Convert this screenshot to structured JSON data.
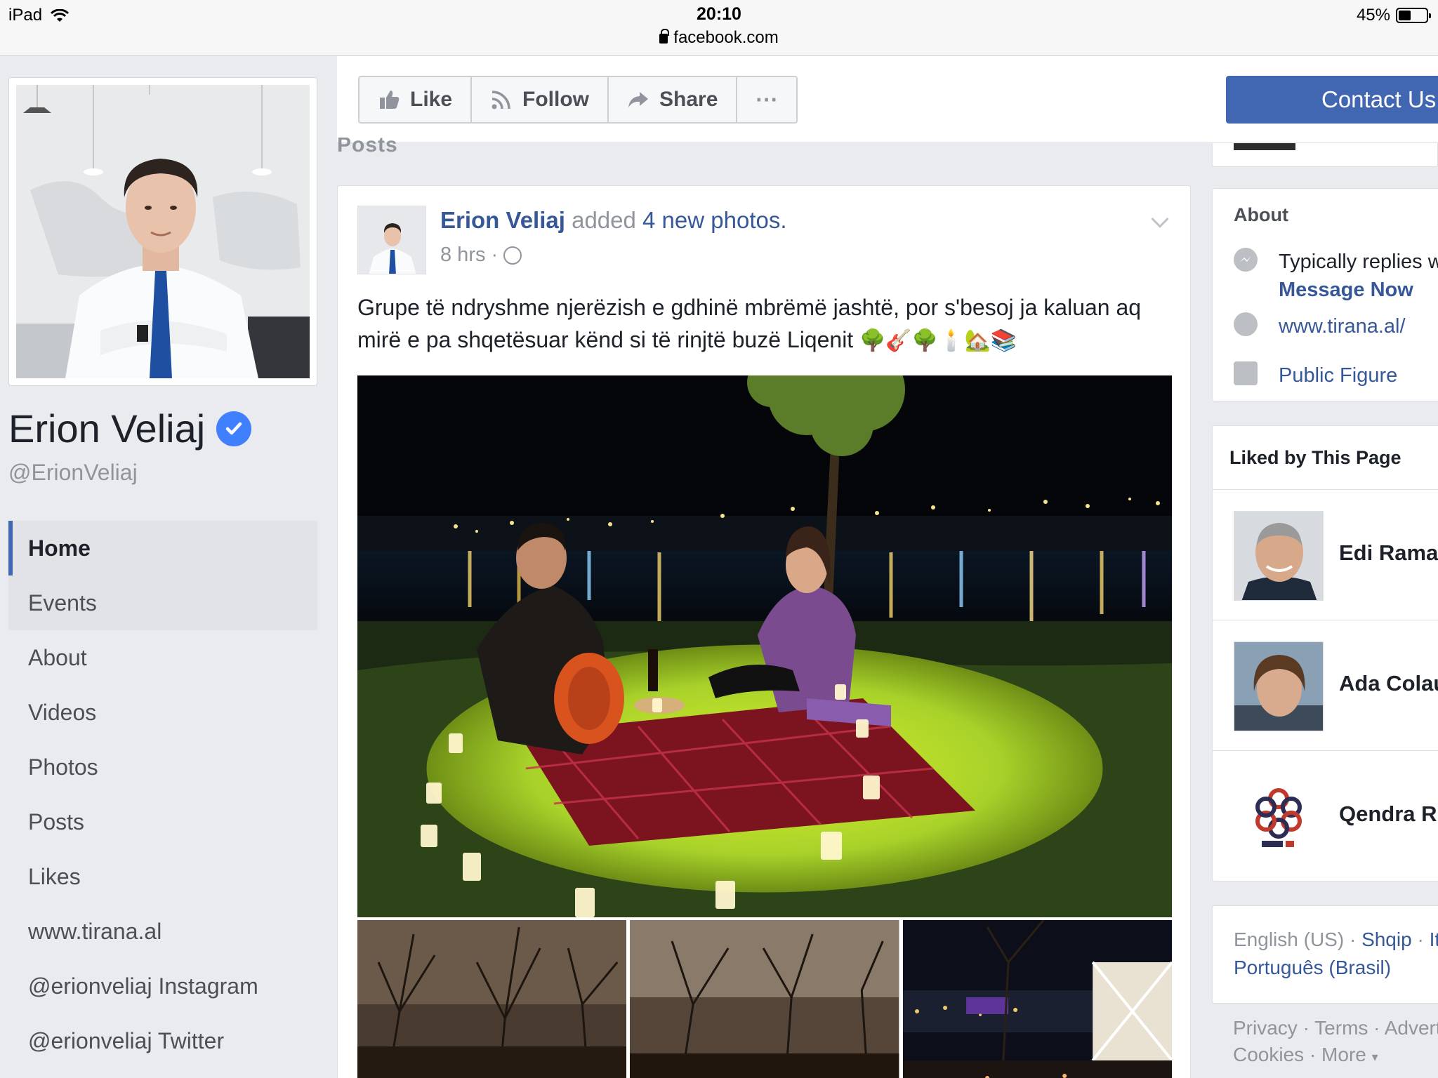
{
  "statusbar": {
    "device": "iPad",
    "time": "20:10",
    "url": "facebook.com",
    "battery": "45%",
    "battery_level": 0.45
  },
  "profile": {
    "name": "Erion Veliaj",
    "handle": "@ErionVeliaj"
  },
  "nav": {
    "items": [
      {
        "label": "Home"
      },
      {
        "label": "Events"
      },
      {
        "label": "About"
      },
      {
        "label": "Videos"
      },
      {
        "label": "Photos"
      },
      {
        "label": "Posts"
      },
      {
        "label": "Likes"
      },
      {
        "label": "www.tirana.al"
      },
      {
        "label": "@erionveliaj Instagram"
      },
      {
        "label": "@erionveliaj Twitter"
      }
    ]
  },
  "actions": {
    "like": "Like",
    "follow": "Follow",
    "share": "Share",
    "more": "···",
    "contact": "Contact Us"
  },
  "posts_heading": "Posts",
  "post": {
    "author": "Erion Veliaj",
    "action_text": " added ",
    "action_link": "4 new photos.",
    "time": "8 hrs ·",
    "text": "Grupe të ndryshme njerëzish e gdhinë mbrëmë jashtë, por s'besoj ja kaluan aq mirë e pa shqetësuar kënd si të rinjtë buzë Liqenit",
    "emojis": "🌳🎸🌳🕯️🏡📚"
  },
  "about": {
    "title": "About",
    "replies": "Typically replies within",
    "message_now": "Message Now",
    "website": "www.tirana.al/",
    "category": "Public Figure"
  },
  "liked": {
    "title": "Liked by This Page",
    "pages": [
      {
        "name": "Edi Rama"
      },
      {
        "name": "Ada Colau"
      },
      {
        "name": "Qendra Rinore"
      }
    ]
  },
  "languages": {
    "current": "English (US)",
    "sep": " · ",
    "alt1": "Shqip",
    "alt2": "Italiano",
    "alt3": "Português (Brasil)"
  },
  "footer": {
    "line1": "Privacy · Terms · Advertising",
    "line2": "Cookies · More"
  },
  "colors": {
    "brand": "#4267b2",
    "link": "#365899",
    "background": "#e9ebee",
    "verified": "#4080ff"
  }
}
